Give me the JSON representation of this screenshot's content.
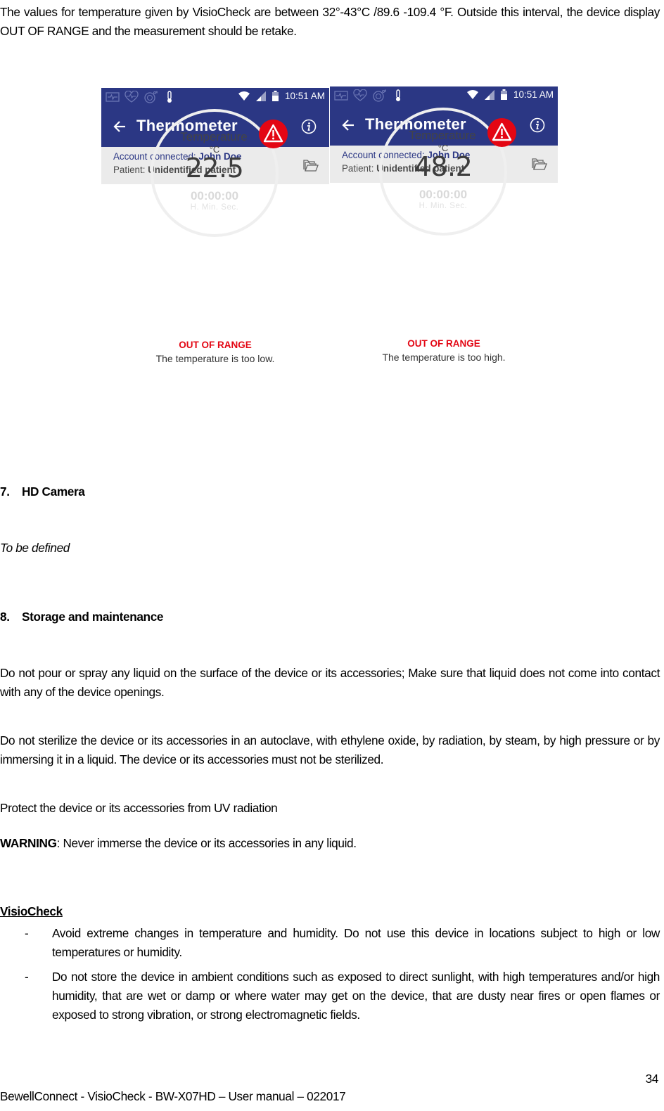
{
  "intro": "The values for temperature given by VisioCheck are between 32°-43°C /89.6 -109.4 °F. Outside this interval, the device display OUT OF RANGE and the measurement should be retake.",
  "screens": [
    {
      "status_time": "10:51 AM",
      "app_title": "Thermometer",
      "account_label": "Account connected: ",
      "account_name": "John Doe",
      "patient_label": "Patient: ",
      "patient_name": "Unidentified patient",
      "gauge_label": "Temperature",
      "unit": "°C",
      "value": "22.5",
      "timer": "00:00:00",
      "timer_label": "H.  Min. Sec.",
      "status_title": "OUT OF RANGE",
      "status_message": "The temperature is too low."
    },
    {
      "status_time": "10:51 AM",
      "app_title": "Thermometer",
      "account_label": "Account connected: ",
      "account_name": "John Doe",
      "patient_label": "Patient: ",
      "patient_name": "Unidentified patient",
      "gauge_label": "Temperature",
      "unit": "°C",
      "value": "48.2",
      "timer": "00:00:00",
      "timer_label": "H.  Min. Sec.",
      "status_title": "OUT OF RANGE",
      "status_message": "The temperature is too high."
    }
  ],
  "colors": {
    "app_bar": "#2b3784",
    "alert_red": "#e30613",
    "account_bar": "#ebebeb"
  },
  "section7": {
    "number": "7.",
    "title": "HD Camera",
    "body": "To be defined"
  },
  "section8": {
    "number": "8.",
    "title": "Storage and maintenance",
    "p1": "Do not pour or spray any liquid on the surface of the device or its accessories; Make sure that liquid does not come into contact with any of the device openings.",
    "p2": "Do not sterilize the device or its accessories in an autoclave, with ethylene oxide, by radiation, by steam, by high pressure or by immersing it in a liquid. The device or its accessories must not be sterilized.",
    "p3": "Protect the device or its accessories from UV radiation",
    "warning_label": "WARNING",
    "warning_text": ": Never immerse the device or its accessories in any liquid.",
    "subheading": "VisioCheck",
    "bullets": [
      "Avoid extreme changes in temperature and humidity. Do not use this device in locations subject to high or low temperatures or humidity.",
      "Do not store the device in ambient conditions such as exposed to direct sunlight, with high temperatures and/or high humidity, that are wet or damp or where water may get on the device, that are dusty near fires or open flames or exposed to strong vibration, or strong electromagnetic fields."
    ],
    "bullet_marker": "-"
  },
  "footer": {
    "page_number": "34",
    "text": "BewellConnect - VisioCheck - BW-X07HD – User manual – 022017"
  }
}
